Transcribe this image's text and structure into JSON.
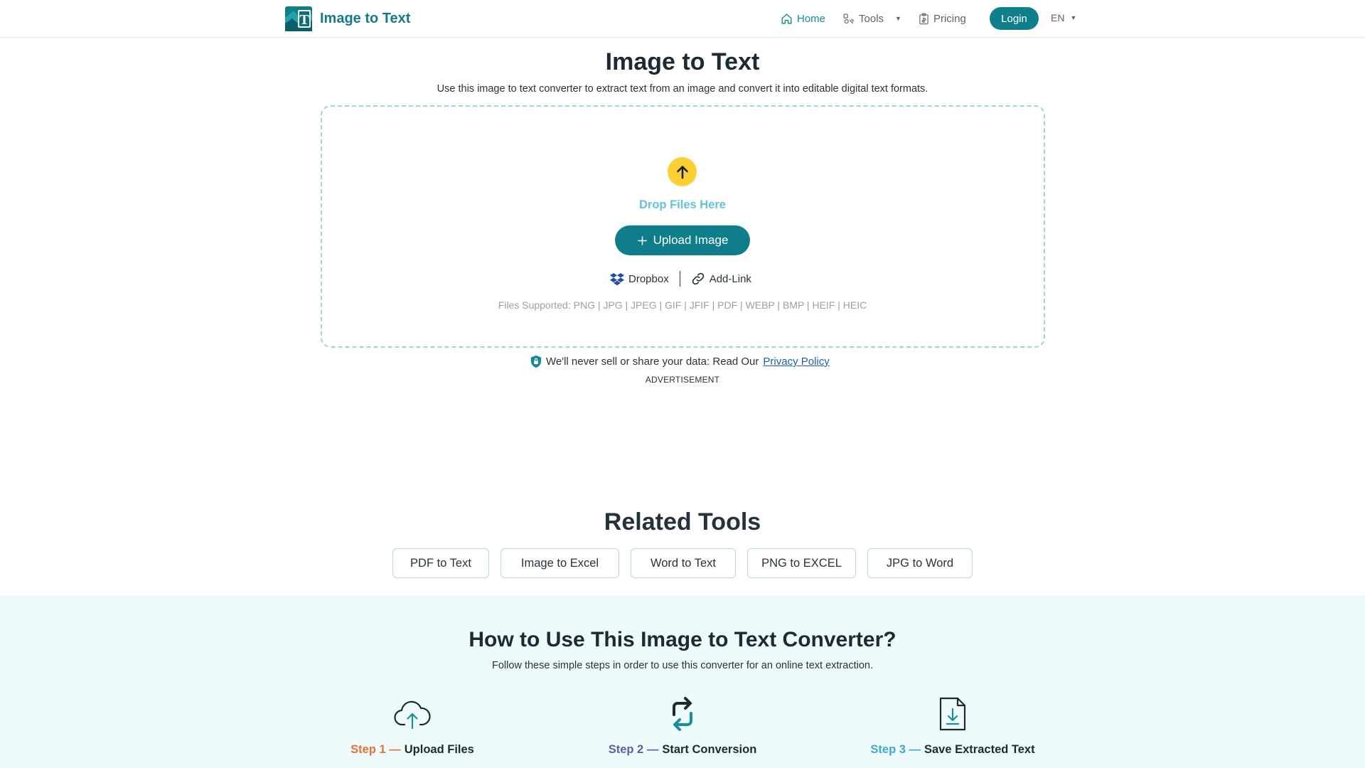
{
  "header": {
    "logo_letter": "T",
    "logo_text": "Image to Text",
    "nav": [
      {
        "label": "Home",
        "icon": "home-icon"
      },
      {
        "label": "Tools",
        "icon": "tools-icon"
      },
      {
        "label": "Pricing",
        "icon": "pricing-icon"
      }
    ],
    "login_label": "Login",
    "language": "EN"
  },
  "hero": {
    "title": "Image to Text",
    "subtitle": "Use this image to text converter to extract text from an image and convert it into editable digital text formats.",
    "drop_label": "Drop Files Here",
    "upload_label": "Upload Image",
    "sources": [
      {
        "label": "Dropbox",
        "icon": "dropbox-icon"
      },
      {
        "label": "Add-Link",
        "icon": "link-icon"
      }
    ],
    "supported": "Files Supported: PNG | JPG | JPEG | GIF | JFIF | PDF | WEBP | BMP | HEIF | HEIC",
    "privacy_text": "We'll never sell or share your data: Read Our",
    "privacy_link": "Privacy Policy",
    "ad_label": "ADVERTISEMENT"
  },
  "related": {
    "title": "Related Tools",
    "tools": [
      "PDF to Text",
      "Image to Excel",
      "Word to Text",
      "PNG to EXCEL",
      "JPG to Word"
    ]
  },
  "howto": {
    "title": "How to Use This Image to Text Converter?",
    "subtitle": "Follow these simple steps in order to use this converter for an online text extraction.",
    "steps": [
      {
        "num": "Step 1 —",
        "text": "Upload Files",
        "color": "#e8713e"
      },
      {
        "num": "Step 2 —",
        "text": "Start Conversion",
        "color": "#5a5fa6"
      },
      {
        "num": "Step 3 —",
        "text": "Save Extracted Text",
        "color": "#3fa8cf"
      }
    ]
  },
  "colors": {
    "brand": "#107f8c",
    "accent_yellow": "#fbd032",
    "dashed_border": "#9cd8d2",
    "howto_bg": "#effafa"
  }
}
